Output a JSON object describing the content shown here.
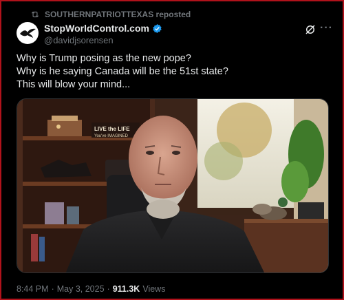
{
  "repost": {
    "label": "SOUTHERNPATRIOTTEXAS reposted",
    "icon": "repost-icon"
  },
  "author": {
    "display_name": "StopWorldControl.com",
    "handle": "@davidjsorensen",
    "verified": true,
    "verified_color": "#1d9bf0",
    "avatar_icon": "bird-logo"
  },
  "tweet": {
    "lines": [
      "Why is Trump posing as the new pope?",
      "Why is he saying Canada will be the 51st state?",
      "This will blow your mind..."
    ]
  },
  "video": {
    "sign_text_1": "LIVE the LIFE",
    "sign_text_2": "You've IMAGINED"
  },
  "meta": {
    "time": "8:44 PM",
    "separator": "·",
    "date": "May 3, 2025",
    "views_count": "911.3K",
    "views_label": "Views"
  },
  "colors": {
    "background": "#000000",
    "border": "#b0121b",
    "muted": "#71767b",
    "text": "#e7e9ea"
  }
}
